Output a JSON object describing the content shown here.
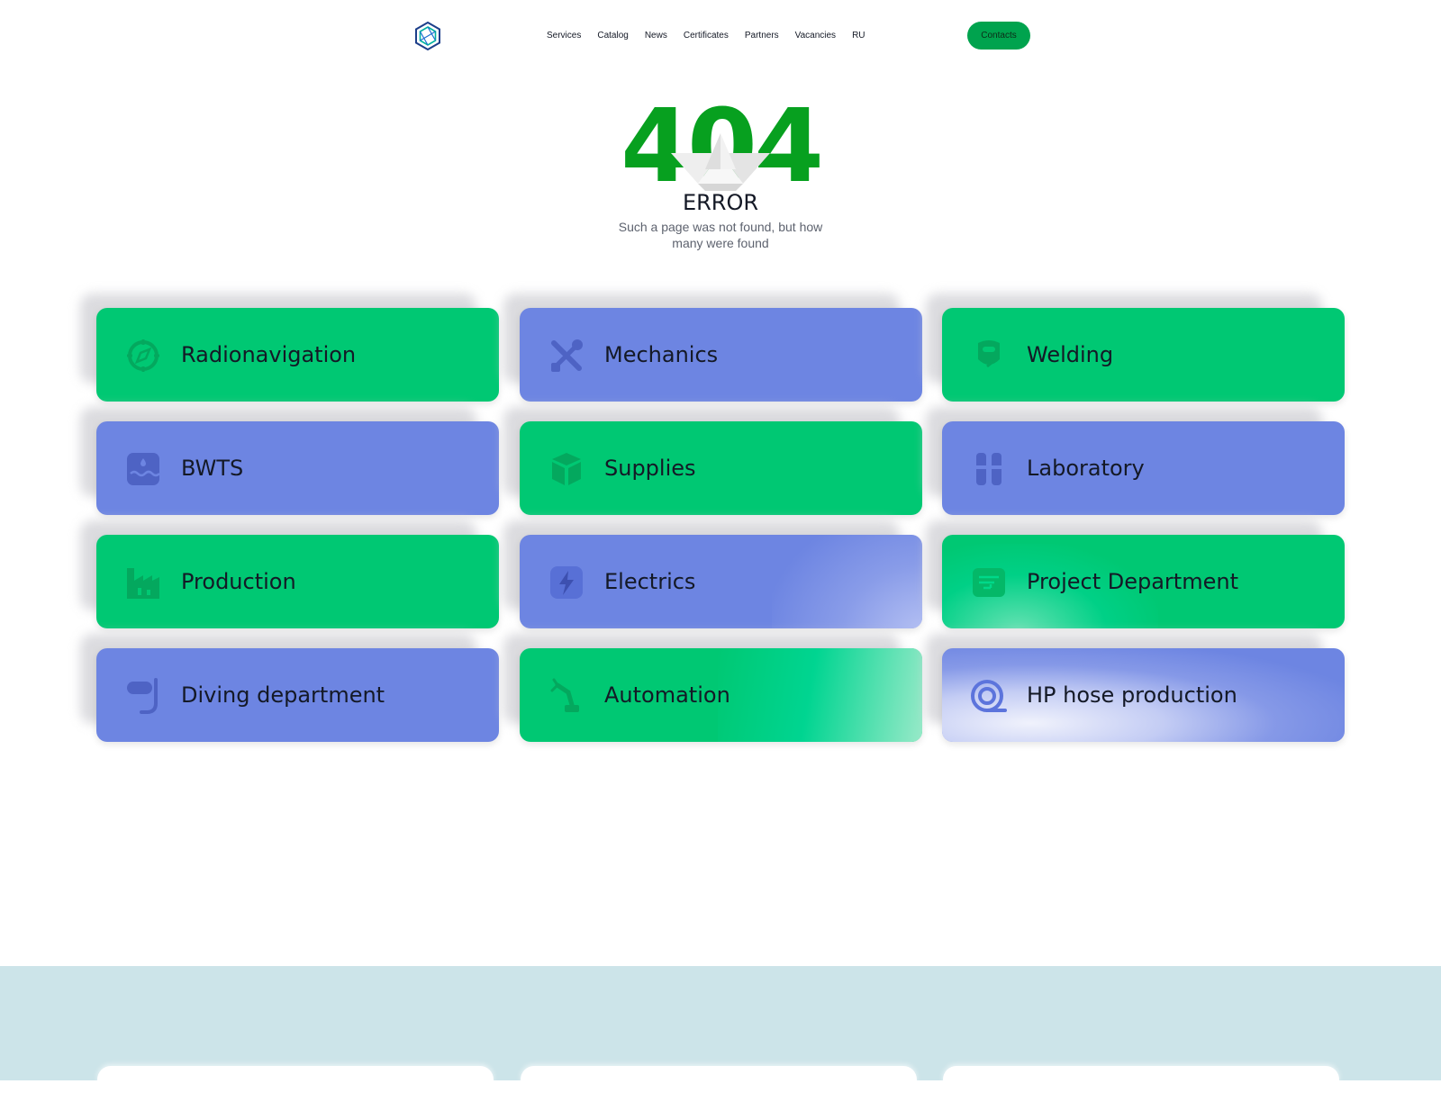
{
  "header": {
    "logo_icon": "hexagon-logo-icon",
    "nav": [
      "Services",
      "Catalog",
      "News",
      "Certificates",
      "Partners",
      "Vacancies",
      "RU"
    ],
    "contacts_label": "Contacts"
  },
  "hero": {
    "code": "404",
    "title": "ERROR",
    "subtitle": "Such a page was not found, but how many were found"
  },
  "colors": {
    "accent_green": "#00c873",
    "accent_blue": "#6d85e2",
    "hero_green": "#07a01f",
    "button_green": "#00a34e",
    "footer_band": "#cce4e9"
  },
  "cards": [
    {
      "label": "Radionavigation",
      "color": "green",
      "icon": "compass-icon"
    },
    {
      "label": "Mechanics",
      "color": "blue",
      "icon": "tools-icon"
    },
    {
      "label": "Welding",
      "color": "green",
      "icon": "welding-mask-icon"
    },
    {
      "label": "BWTS",
      "color": "blue",
      "icon": "water-tank-icon"
    },
    {
      "label": "Supplies",
      "color": "green",
      "icon": "box-icon"
    },
    {
      "label": "Laboratory",
      "color": "blue",
      "icon": "test-tubes-icon"
    },
    {
      "label": "Production",
      "color": "green",
      "icon": "factory-icon"
    },
    {
      "label": "Electrics",
      "color": "blue",
      "icon": "lightning-icon"
    },
    {
      "label": "Project Department",
      "color": "green",
      "icon": "blueprint-icon"
    },
    {
      "label": "Diving department",
      "color": "blue",
      "icon": "diving-mask-icon"
    },
    {
      "label": "Automation",
      "color": "green",
      "icon": "robot-arm-icon"
    },
    {
      "label": "HP hose production",
      "color": "blue",
      "icon": "hose-reel-icon"
    }
  ]
}
